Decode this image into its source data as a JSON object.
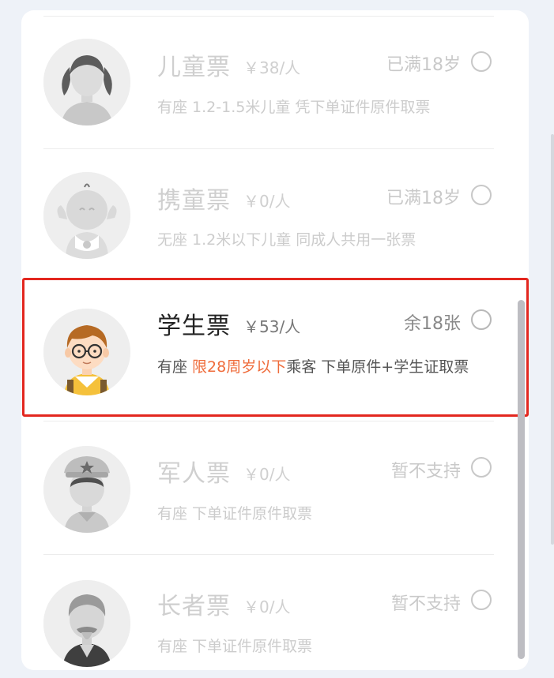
{
  "tickets": [
    {
      "name": "儿童票",
      "price": "￥38/人",
      "status": "已满18岁",
      "desc": "有座 1.2-1.5米儿童 凭下单证件原件取票",
      "avatar": "girl-avatar",
      "selected": false
    },
    {
      "name": "携童票",
      "price": "￥0/人",
      "status": "已满18岁",
      "desc": "无座 1.2米以下儿童 同成人共用一张票",
      "avatar": "baby-avatar",
      "selected": false
    },
    {
      "name": "学生票",
      "price": "￥53/人",
      "status": "余18张",
      "desc_prefix": "有座 ",
      "desc_highlight": "限28周岁以下",
      "desc_suffix": "乘客 下单原件+学生证取票",
      "avatar": "student-avatar",
      "selected": false
    },
    {
      "name": "军人票",
      "price": "￥0/人",
      "status": "暂不支持",
      "desc": "有座 下单证件原件取票",
      "avatar": "soldier-avatar",
      "selected": false
    },
    {
      "name": "长者票",
      "price": "￥0/人",
      "status": "暂不支持",
      "desc": "有座 下单证件原件取票",
      "avatar": "elder-avatar",
      "selected": false
    }
  ],
  "colors": {
    "highlight": "#ef6b3a",
    "focus_border": "#e3271f",
    "disabled_text": "#cfcfcf"
  }
}
